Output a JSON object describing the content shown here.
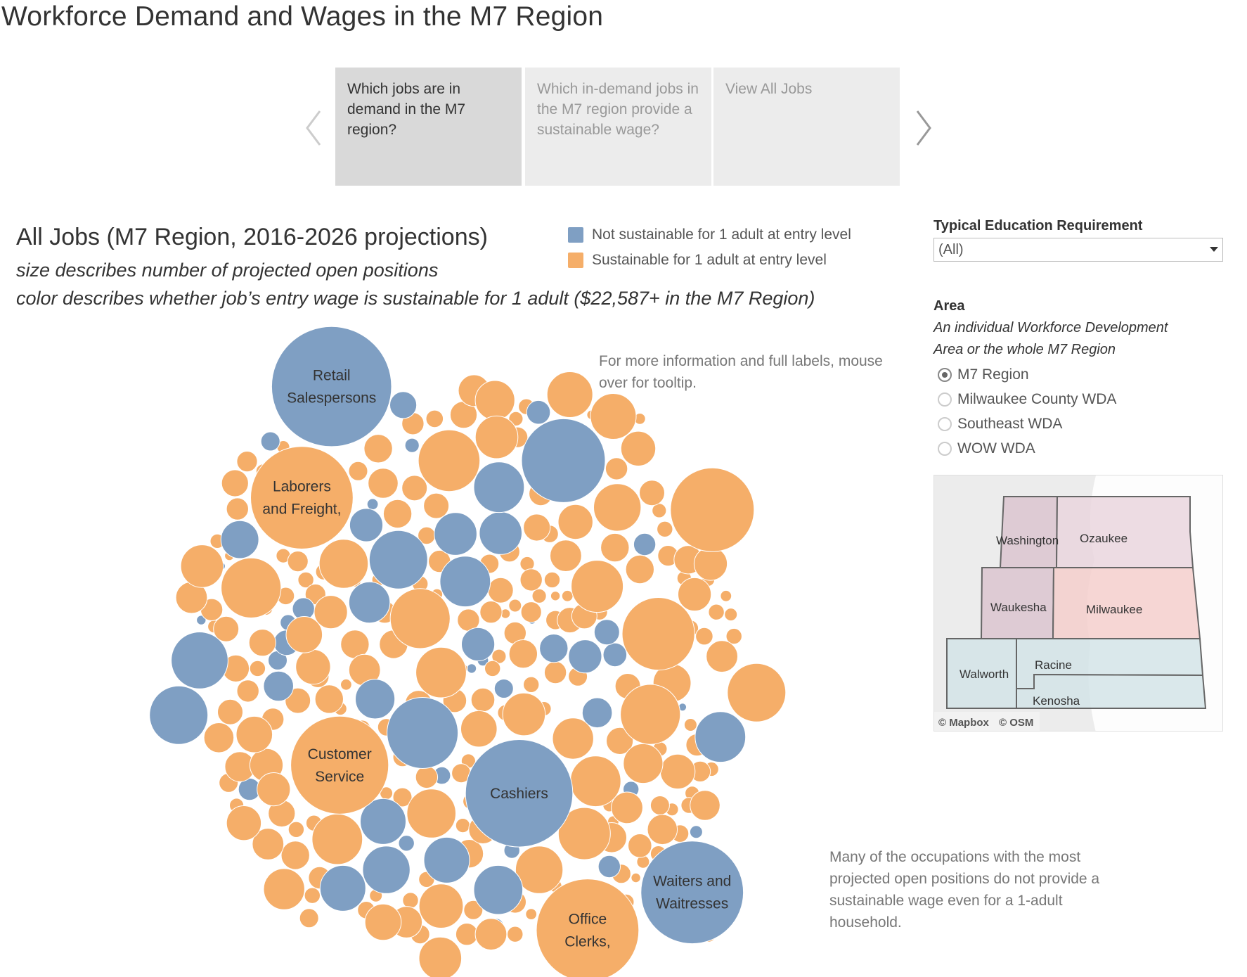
{
  "page": {
    "title": "Workforce Demand and Wages in the M7 Region"
  },
  "story": {
    "tabs": [
      {
        "label": "Which jobs are in demand in the M7 region?",
        "active": true
      },
      {
        "label": "Which in-demand jobs in the M7 region provide a sustainable wage?",
        "active": false
      },
      {
        "label": "View All Jobs",
        "active": false
      }
    ],
    "prev_icon": "chevron-left-icon",
    "next_icon": "chevron-right-icon"
  },
  "viz": {
    "title": "All Jobs (M7 Region, 2016-2026 projections)",
    "subtitle_size": "size describes number of projected open positions",
    "subtitle_color": "color describes whether job’s entry wage is sustainable for 1 adult ($22,587+ in the M7 Region)",
    "note": "For more information and full labels, mouse over for tooltip.",
    "callout": "Many of the occupations with the most projected open positions do not provide a sustainable wage even for a 1-adult household."
  },
  "legend": {
    "items": [
      {
        "label": "Not sustainable for 1 adult at entry level",
        "color": "#7f9fc3"
      },
      {
        "label": "Sustainable for 1 adult at entry level",
        "color": "#f5ae69"
      }
    ]
  },
  "filters": {
    "education": {
      "label": "Typical Education Requirement",
      "value": "(All)"
    },
    "area": {
      "label": "Area",
      "description_line1": "An individual Workforce Development",
      "description_line2": "Area or the whole M7 Region",
      "options": [
        {
          "label": "M7 Region",
          "selected": true
        },
        {
          "label": "Milwaukee County WDA",
          "selected": false
        },
        {
          "label": "Southeast WDA",
          "selected": false
        },
        {
          "label": "WOW WDA",
          "selected": false
        }
      ]
    }
  },
  "map": {
    "counties": [
      "Washington",
      "Ozaukee",
      "Waukesha",
      "Milwaukee",
      "Walworth",
      "Racine",
      "Kenosha"
    ],
    "colors": {
      "WOW": "#dcc6d0",
      "Ozaukee": "#ead6de",
      "Milwaukee": "#f5cfcd",
      "Southeast": "#d4e4e8"
    },
    "attribution": [
      "© Mapbox",
      "© OSM"
    ]
  },
  "chart_data": {
    "type": "packed-bubble",
    "title": "All Jobs (M7 Region, 2016-2026 projections)",
    "size_measure": "number of projected open positions",
    "color_measure": "entry wage sustainable for 1 adult ($22,587+)",
    "legend": [
      "Not sustainable for 1 adult at entry level",
      "Sustainable for 1 adult at entry level"
    ],
    "labeled_bubbles": [
      {
        "label": "Retail Salespersons",
        "sustainable": false,
        "relative_size": 1.0
      },
      {
        "label": "Cashiers",
        "sustainable": false,
        "relative_size": 0.8
      },
      {
        "label": "Laborers and Freight,",
        "sustainable": true,
        "relative_size": 0.73
      },
      {
        "label": "Waiters and Waitresses",
        "sustainable": false,
        "relative_size": 0.73
      },
      {
        "label": "Office Clerks,",
        "sustainable": true,
        "relative_size": 0.73
      },
      {
        "label": "Customer Service",
        "sustainable": true,
        "relative_size": 0.67
      }
    ]
  }
}
